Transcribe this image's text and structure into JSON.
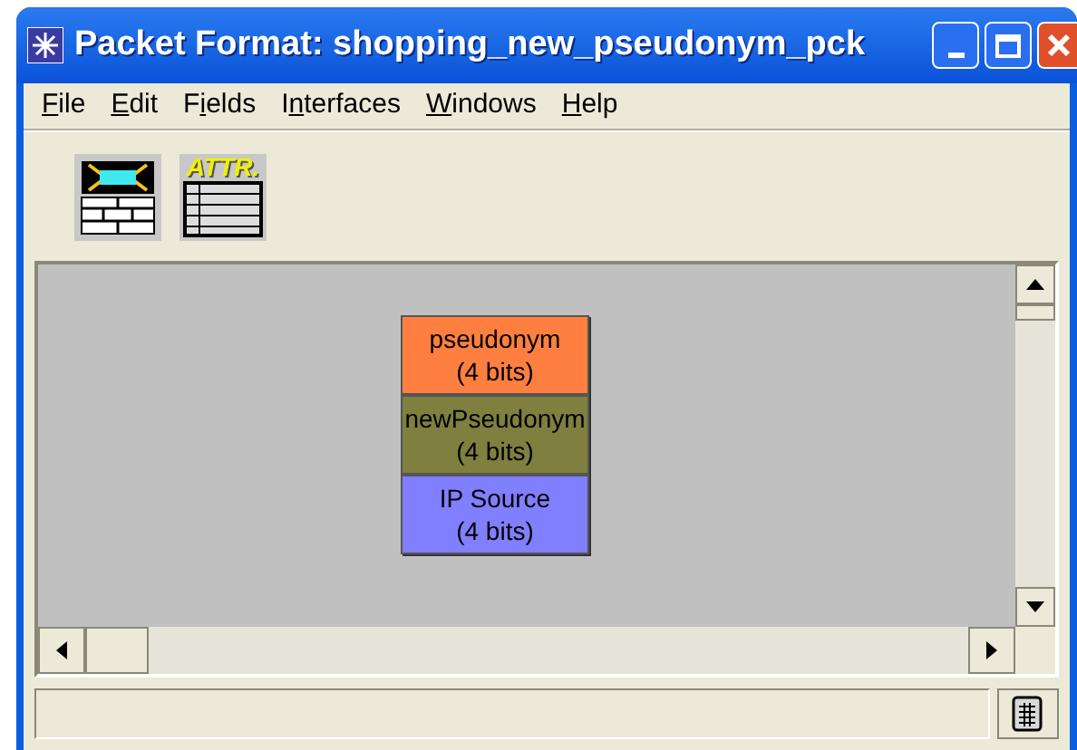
{
  "window": {
    "title": "Packet Format: shopping_new_pseudonym_pck"
  },
  "menu": [
    {
      "access_key": "F",
      "after": "ile"
    },
    {
      "access_key": "E",
      "after": "dit"
    },
    {
      "before": "F",
      "access_key": "i",
      "after": "elds"
    },
    {
      "before": "I",
      "access_key": "n",
      "after": "terfaces"
    },
    {
      "access_key": "W",
      "after": "indows"
    },
    {
      "access_key": "H",
      "after": "elp"
    }
  ],
  "toolbar": [
    {
      "kind": "field_block"
    },
    {
      "kind": "attributes",
      "label": "ATTR."
    }
  ],
  "fields": [
    {
      "name": "pseudonym",
      "size": "(4 bits)",
      "color": "#ff7f40"
    },
    {
      "name": "newPseudonym",
      "size": "(4 bits)",
      "color": "#7f7f3f"
    },
    {
      "name": "IP Source",
      "size": "(4 bits)",
      "color": "#7f7fff"
    }
  ]
}
